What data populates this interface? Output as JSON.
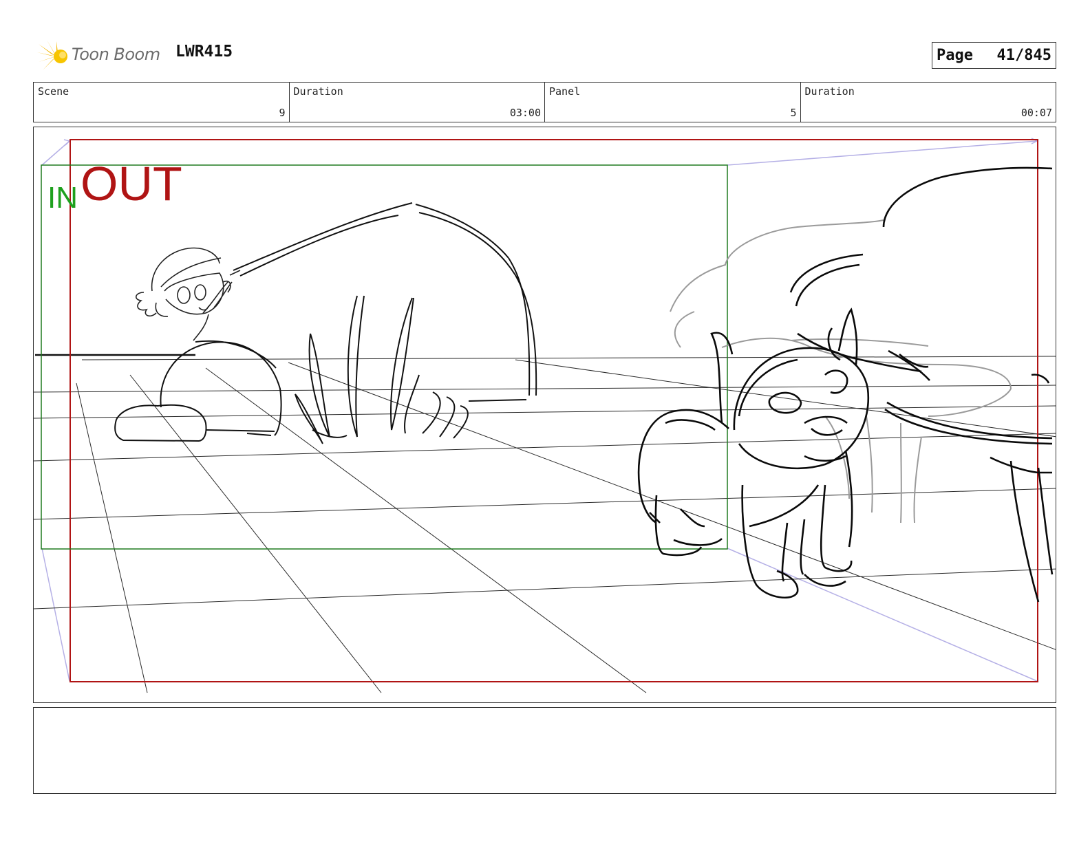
{
  "header": {
    "logo_text": "Toon Boom",
    "production_code": "LWR415",
    "page_label": "Page",
    "page_value": "41/845"
  },
  "info": {
    "scene_label": "Scene",
    "scene_value": "9",
    "scene_duration_label": "Duration",
    "scene_duration_value": "03:00",
    "panel_label": "Panel",
    "panel_value": "5",
    "panel_duration_label": "Duration",
    "panel_duration_value": "00:07"
  },
  "panel": {
    "in_label": "IN",
    "out_label": "OUT",
    "in_color": "#1ea01e",
    "out_color": "#b01414"
  },
  "notes": {
    "text": ""
  }
}
